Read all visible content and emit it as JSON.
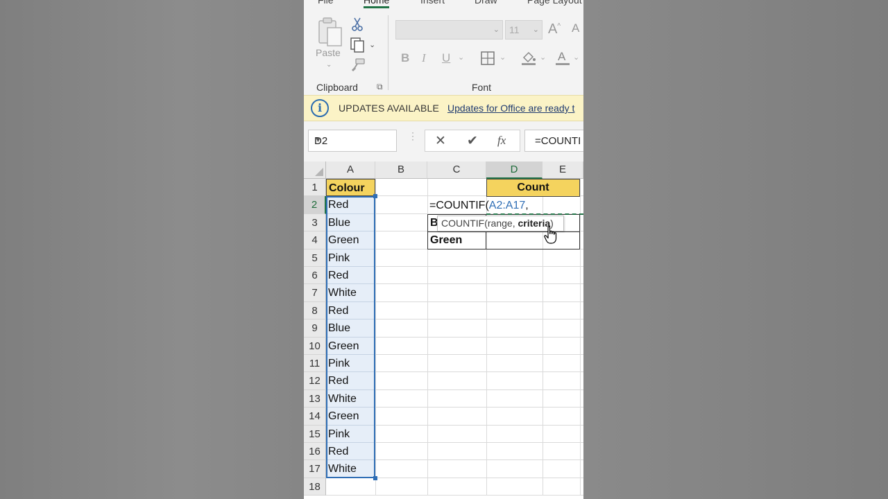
{
  "ribbon": {
    "tabs": [
      "File",
      "Home",
      "Insert",
      "Draw",
      "Page Layout"
    ],
    "active_tab": "Home",
    "paste_label": "Paste",
    "clipboard_label": "Clipboard",
    "font_group_label": "Font",
    "font_size": "11",
    "bold_glyph": "B",
    "italic_glyph": "I",
    "underline_glyph": "U"
  },
  "updates_bar": {
    "title": "UPDATES AVAILABLE",
    "link": "Updates for Office are ready t"
  },
  "formula_bar": {
    "name_box": "D2",
    "formula": "=COUNTI",
    "fx_glyph": "fx"
  },
  "columns": [
    "A",
    "B",
    "C",
    "D",
    "E"
  ],
  "rows": [
    "1",
    "2",
    "3",
    "4",
    "5",
    "6",
    "7",
    "8",
    "9",
    "10",
    "11",
    "12",
    "13",
    "14",
    "15",
    "16",
    "17",
    "18"
  ],
  "column_a": {
    "header": "Colour",
    "values": [
      "Red",
      "Blue",
      "Green",
      "Pink",
      "Red",
      "White",
      "Red",
      "Blue",
      "Green",
      "Pink",
      "Red",
      "White",
      "Green",
      "Pink",
      "Red",
      "White"
    ]
  },
  "count_header": "Count",
  "cell_c3_visible": "B",
  "cell_c4": "Green",
  "editing_cell": {
    "prefix": "=COUNTIF(",
    "range_ref": "A2:A17",
    "suffix": ","
  },
  "tooltip": {
    "func": "COUNTIF",
    "args_prefix": "(range, ",
    "current_arg": "criteria",
    "args_suffix": ")"
  },
  "colors": {
    "accent": "#217346",
    "header_fill": "#f4d35e",
    "range_border": "#2f6eb5",
    "updates_bar": "#fbf3c6"
  }
}
